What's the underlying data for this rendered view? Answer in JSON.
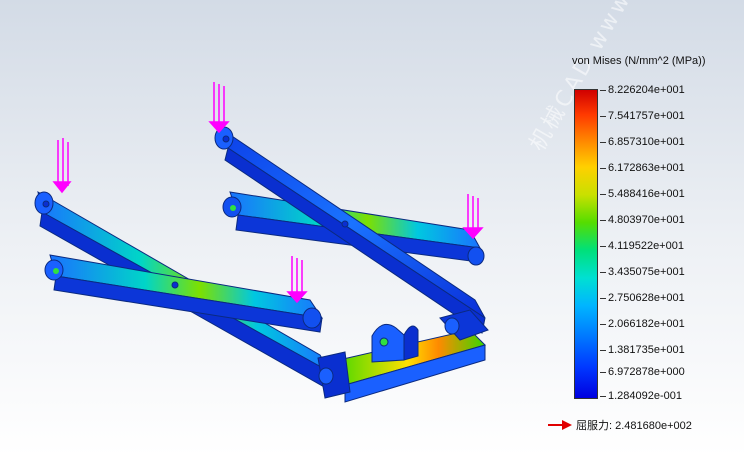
{
  "legend": {
    "title": "von Mises (N/mm^2 (MPa))",
    "ticks": [
      "8.226204e+001",
      "7.541757e+001",
      "6.857310e+001",
      "6.172863e+001",
      "5.488416e+001",
      "4.803970e+001",
      "4.119522e+001",
      "3.435075e+001",
      "2.750628e+001",
      "2.066182e+001",
      "1.381735e+001",
      "6.972878e+000",
      "1.284092e-001"
    ],
    "colors": [
      "#d00000",
      "#ff8c00",
      "#ffd000",
      "#55dd00",
      "#00e0d2",
      "#0078ff",
      "#0000e0"
    ]
  },
  "yield_label": "屈服力: 2.481680e+002",
  "watermark": "机械CAD   www.jixie.com",
  "colors": {
    "load_arrow": "#ff00ff",
    "yield_arrow": "#e00000",
    "mesh_base": "#1030e0"
  }
}
